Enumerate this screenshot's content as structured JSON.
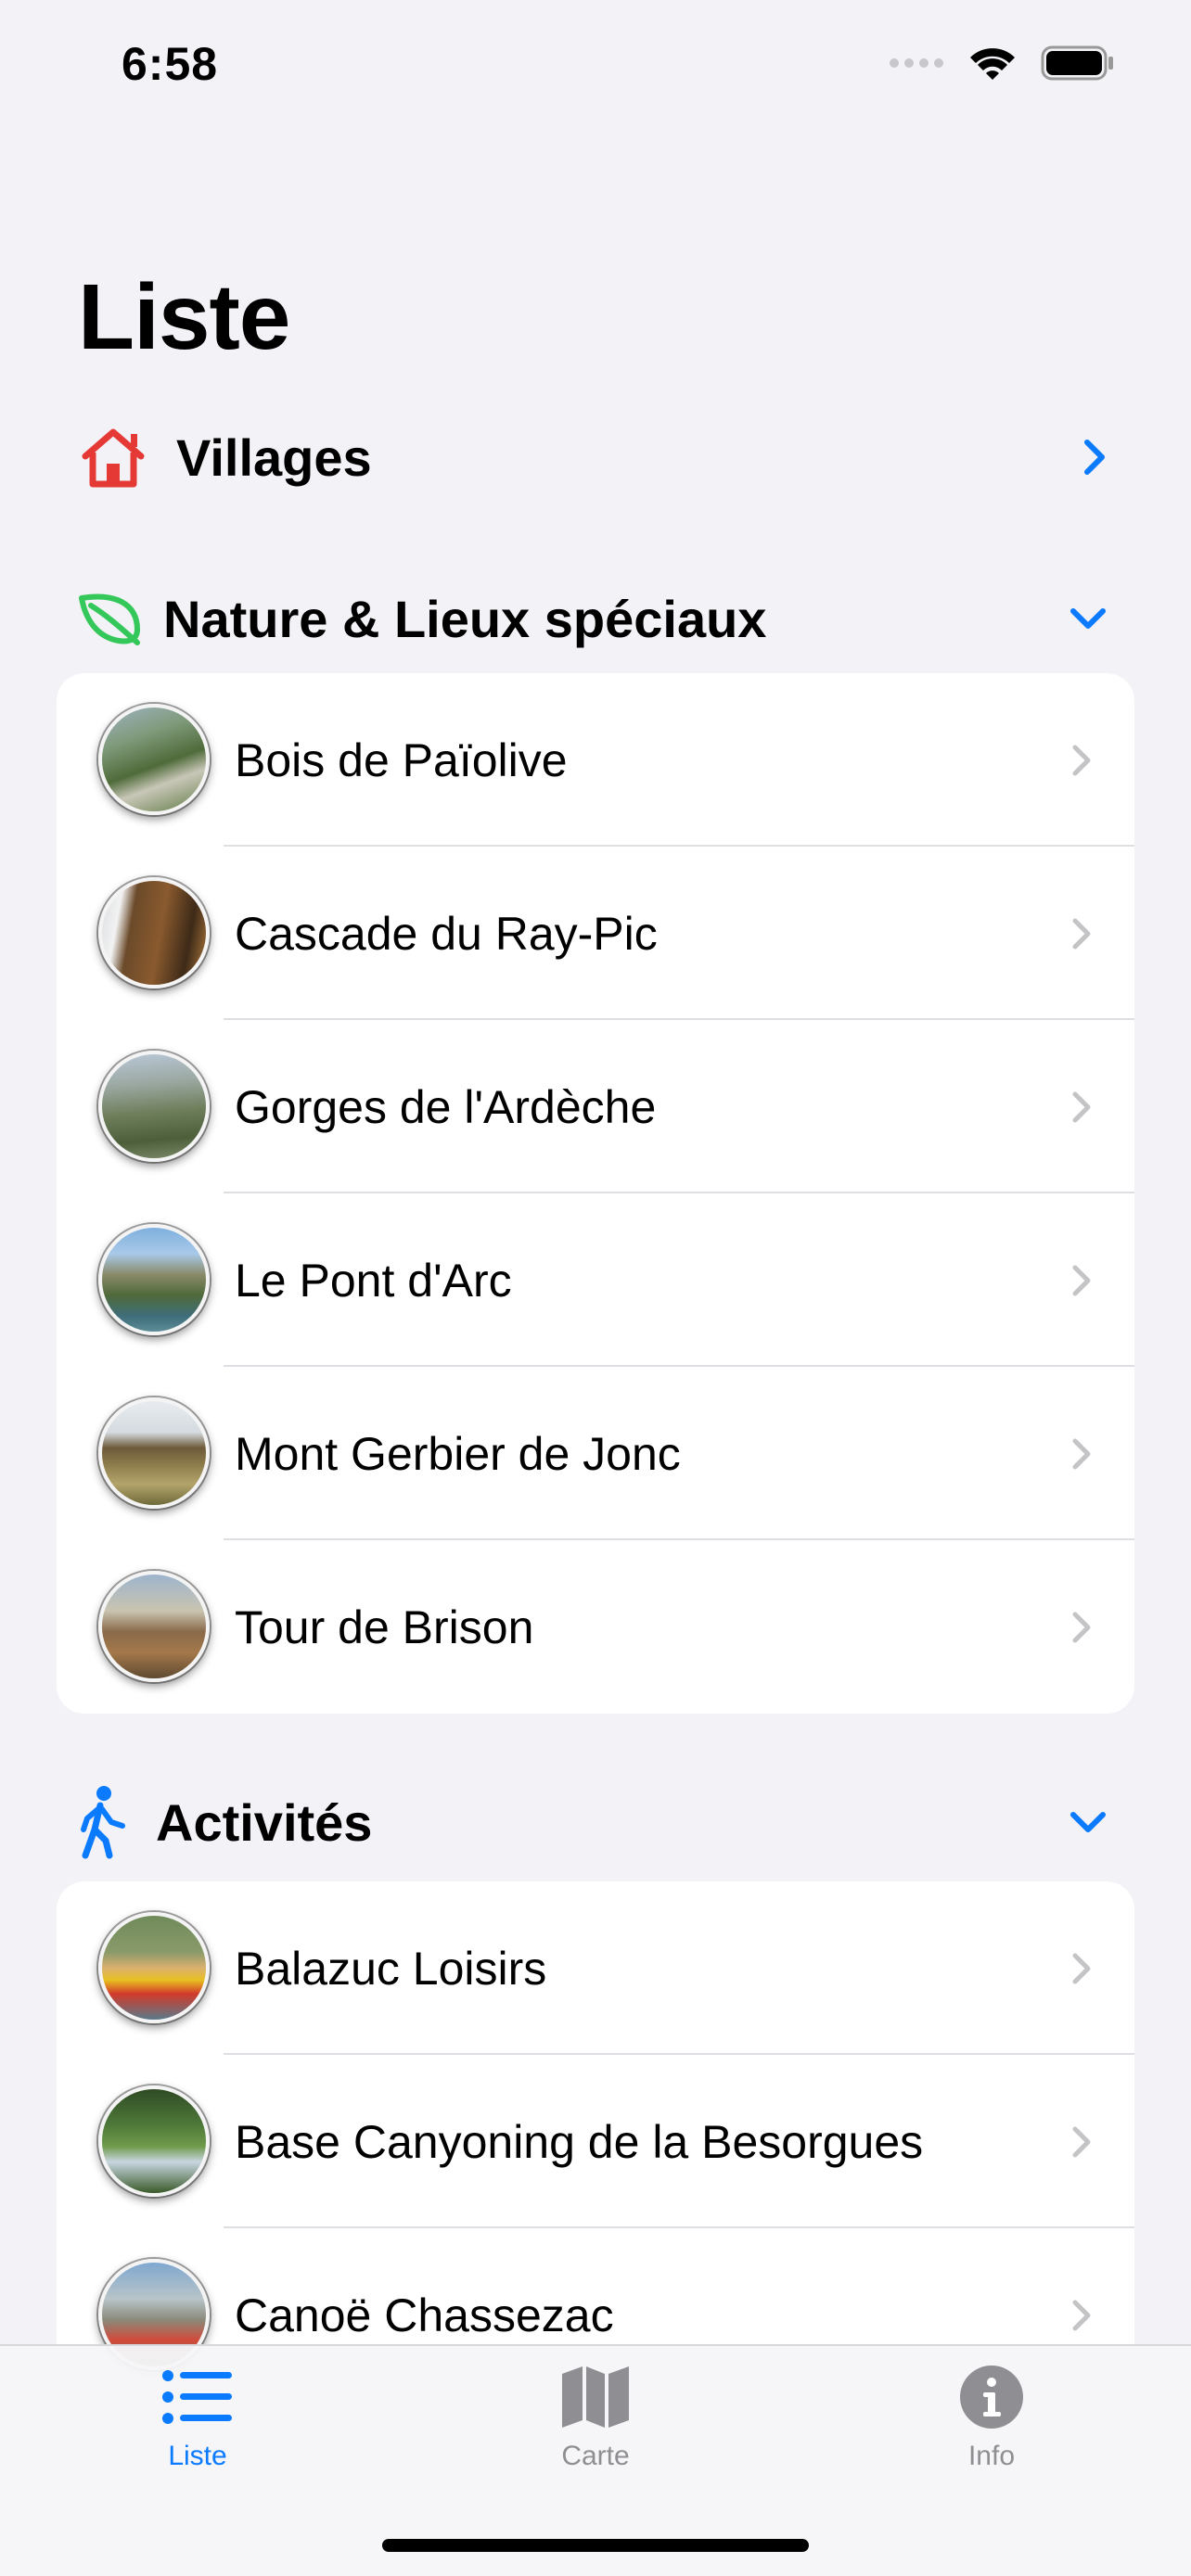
{
  "status_bar": {
    "time": "6:58"
  },
  "page": {
    "title": "Liste"
  },
  "sections": {
    "villages": {
      "label": "Villages"
    },
    "nature": {
      "label": "Nature & Lieux spéciaux",
      "items": [
        {
          "name": "Bois de Païolive"
        },
        {
          "name": "Cascade du Ray-Pic"
        },
        {
          "name": "Gorges de l'Ardèche"
        },
        {
          "name": "Le Pont d'Arc"
        },
        {
          "name": "Mont Gerbier de Jonc"
        },
        {
          "name": "Tour de Brison"
        }
      ]
    },
    "activites": {
      "label": "Activités",
      "items": [
        {
          "name": "Balazuc Loisirs"
        },
        {
          "name": "Base Canyoning de la Besorgues"
        },
        {
          "name": "Canoë Chassezac"
        }
      ]
    }
  },
  "tab_bar": {
    "tabs": [
      {
        "label": "Liste",
        "icon": "list-icon",
        "selected": true
      },
      {
        "label": "Carte",
        "icon": "map-icon",
        "selected": false
      },
      {
        "label": "Info",
        "icon": "info-icon",
        "selected": false
      }
    ]
  },
  "colors": {
    "accent": "#0a7aff",
    "villages_icon": "#e53935",
    "nature_icon": "#34c759",
    "activities_icon": "#0a7aff",
    "tab_inactive": "#8e8e93"
  }
}
